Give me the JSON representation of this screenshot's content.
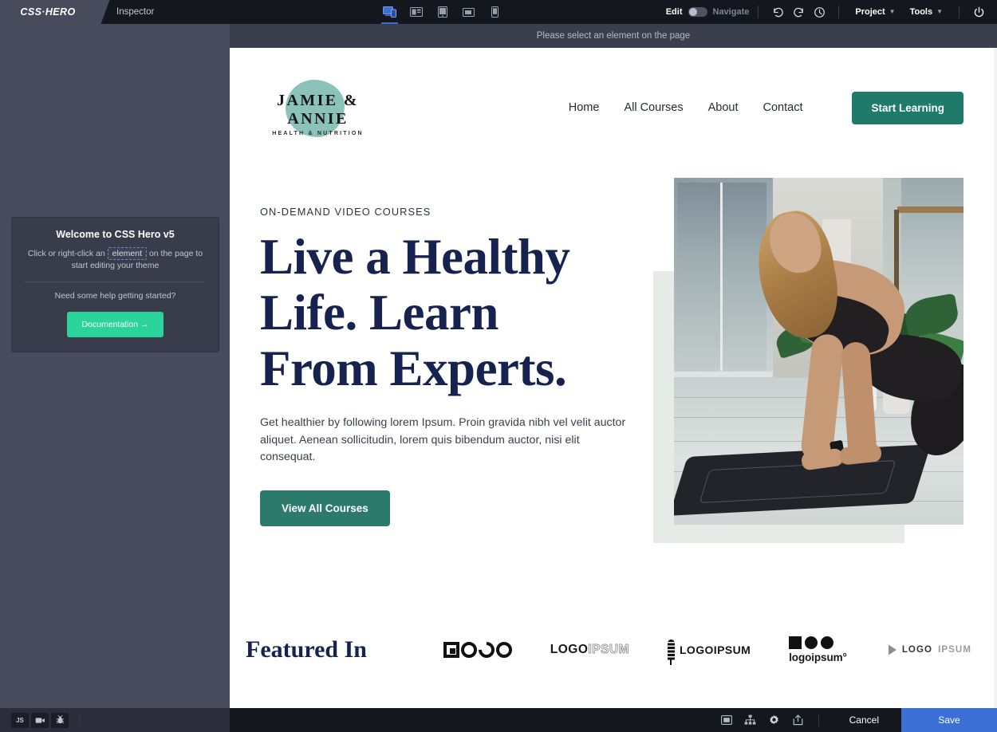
{
  "app": {
    "brand": "CSS·HERO",
    "tab_label": "Inspector",
    "status_message": "Please select an element on the page"
  },
  "topbar": {
    "devices": [
      {
        "name": "device-responsive",
        "icon": "desktop-mobile-icon",
        "active": true
      },
      {
        "name": "device-desktop",
        "icon": "desktop-icon",
        "active": false
      },
      {
        "name": "device-tablet",
        "icon": "tablet-icon",
        "active": false
      },
      {
        "name": "device-tablet-landscape",
        "icon": "tablet-landscape-icon",
        "active": false
      },
      {
        "name": "device-mobile",
        "icon": "mobile-icon",
        "active": false
      }
    ],
    "edit_label": "Edit",
    "navigate_label": "Navigate",
    "toggle_state": "off",
    "undo_icon": "undo-icon",
    "redo_icon": "redo-icon",
    "history_icon": "history-clock-icon",
    "project_label": "Project",
    "tools_label": "Tools",
    "power_icon": "power-icon"
  },
  "sidebar": {
    "welcome": {
      "title": "Welcome to CSS Hero v5",
      "line_before": "Click or right-click an",
      "chip": "element",
      "line_after": "on the page to start editing your theme",
      "help": "Need some help getting started?",
      "doc_button": "Documentation →",
      "doc_button_color": "#2bd49a"
    }
  },
  "site": {
    "logo": {
      "name": "JAMIE & ANNIE",
      "tagline": "HEALTH & NUTRITION",
      "blob_color": "#8cc3b8"
    },
    "nav": [
      {
        "label": "Home"
      },
      {
        "label": "All Courses"
      },
      {
        "label": "About"
      },
      {
        "label": "Contact"
      }
    ],
    "cta": {
      "label": "Start Learning",
      "color": "#1f7a6a"
    },
    "hero": {
      "eyebrow": "ON-DEMAND VIDEO COURSES",
      "title_line1": "Live a Healthy",
      "title_line2": "Life. Learn",
      "title_line3": "From Experts.",
      "title_color": "#17234f",
      "body": "Get healthier by following lorem Ipsum. Proin gravida nibh vel velit auctor aliquet. Aenean sollicitudin, lorem quis bibendum auctor, nisi elit consequat.",
      "button": "View All Courses",
      "button_color": "#2c7a6b",
      "image_alt": "Woman doing a yoga lunge on a mat in a plant-filled studio",
      "backdrop_color": "#e7ebe8"
    },
    "featured": {
      "title": "Featured In",
      "logos": [
        {
          "name": "logo-mark-boxed",
          "text": "LOGO"
        },
        {
          "name": "logo-ipsum-bold",
          "bold": "LOGO",
          "hollow": "IPSUM"
        },
        {
          "name": "logo-ipsum-wheat",
          "text": "LOGOIPSUM"
        },
        {
          "name": "logoipsum-shapes",
          "text": "logoipsum°"
        },
        {
          "name": "logo-ipsum-play",
          "bold": "LOGO",
          "muted": "IPSUM"
        }
      ]
    }
  },
  "bottombar": {
    "left_tools": [
      {
        "name": "js-console-button",
        "label": "JS"
      },
      {
        "name": "screen-recorder-button",
        "label": "video-camera-icon"
      },
      {
        "name": "debug-bug-button",
        "label": "bug-icon"
      }
    ],
    "right_icons": [
      {
        "name": "monitor-icon"
      },
      {
        "name": "sitemap-icon"
      },
      {
        "name": "gear-icon"
      },
      {
        "name": "export-icon"
      }
    ],
    "cancel_label": "Cancel",
    "save_label": "Save",
    "save_color": "#3b6fd4"
  }
}
